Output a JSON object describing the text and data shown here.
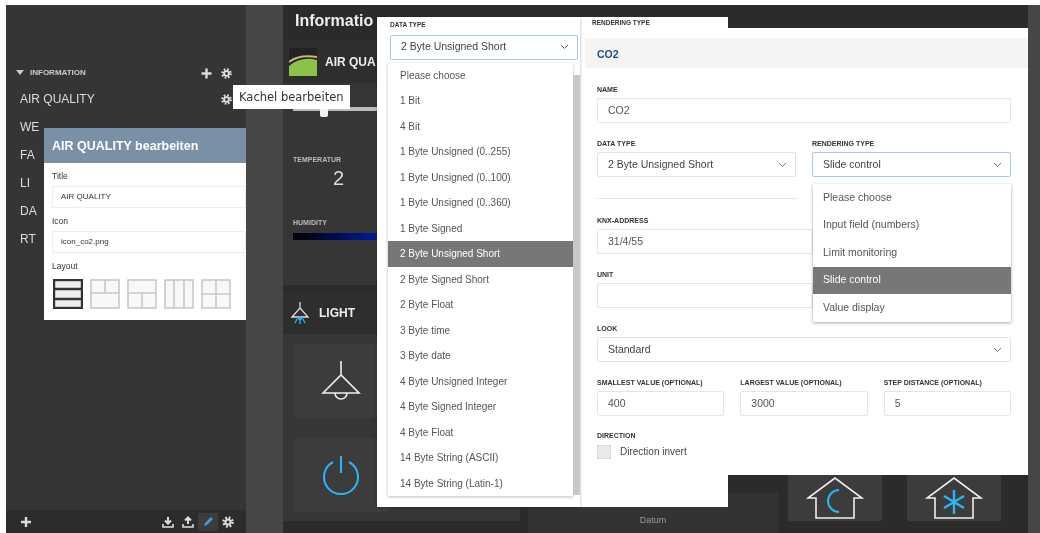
{
  "sidebar": {
    "section": {
      "label": "INFORMATION",
      "expanded": true
    },
    "items": [
      {
        "label": "AIR QUALITY",
        "settings_icon": true
      },
      {
        "label": "WE",
        "settings_icon": false
      },
      {
        "label": "FA",
        "settings_icon": false
      },
      {
        "label": "LI",
        "settings_icon": false
      },
      {
        "label": "DA",
        "settings_icon": false
      },
      {
        "label": "RT",
        "settings_icon": false
      }
    ],
    "toolbar": [
      {
        "kind": "add",
        "selected": false
      },
      {
        "kind": "download",
        "selected": false
      },
      {
        "kind": "upload",
        "selected": false
      },
      {
        "kind": "edit",
        "selected": true
      },
      {
        "kind": "settings",
        "selected": false
      }
    ]
  },
  "tooltip": "Kachel bearbeiten",
  "tile_editor": {
    "title": "AIR QUALITY bearbeiten",
    "fields": [
      {
        "label": "Title",
        "value": "AIR QUALITY"
      },
      {
        "label": "Icon",
        "value": "icon_co2.png"
      }
    ],
    "layout_label": "Layout",
    "layouts": [
      {
        "kind": "rows",
        "selected": true
      },
      {
        "kind": "top-split",
        "selected": false
      },
      {
        "kind": "bottom-split",
        "selected": false
      },
      {
        "kind": "columns",
        "selected": false
      },
      {
        "kind": "grid",
        "selected": false
      }
    ]
  },
  "dashboard": {
    "title": "Informatio",
    "air_quality": {
      "title": "AIR QUA",
      "slider": {
        "level": 0.37
      },
      "temperature": {
        "label": "TEMPERATUR",
        "value": "2"
      },
      "humidity": {
        "label": "HUMIDITY"
      }
    },
    "light": {
      "title": "LIGHT"
    },
    "datum": "Datum"
  },
  "data_type_dropdown": {
    "label": "DATA TYPE",
    "value": "2 Byte Unsigned Short",
    "options": [
      {
        "label": "Please choose",
        "selected": false
      },
      {
        "label": "1 Bit",
        "selected": false
      },
      {
        "label": "4 Bit",
        "selected": false
      },
      {
        "label": "1 Byte Unsigned (0..255)",
        "selected": false
      },
      {
        "label": "1 Byte Unsigned (0..100)",
        "selected": false
      },
      {
        "label": "1 Byte Unsigned (0..360)",
        "selected": false
      },
      {
        "label": "1 Byte Signed",
        "selected": false
      },
      {
        "label": "2 Byte Unsigned Short",
        "selected": true
      },
      {
        "label": "2 Byte Signed Short",
        "selected": false
      },
      {
        "label": "2 Byte Float",
        "selected": false
      },
      {
        "label": "3 Byte time",
        "selected": false
      },
      {
        "label": "3 Byte date",
        "selected": false
      },
      {
        "label": "4 Byte Unsigned Integer",
        "selected": false
      },
      {
        "label": "4 Byte Signed Integer",
        "selected": false
      },
      {
        "label": "4 Byte Float",
        "selected": false
      },
      {
        "label": "14 Byte String (ASCII)",
        "selected": false
      },
      {
        "label": "14 Byte String (Latin-1)",
        "selected": false
      }
    ]
  },
  "rendering_panel": {
    "label": "RENDERING TYPE"
  },
  "channel_dialog": {
    "title": "CO2",
    "name": {
      "label": "NAME",
      "value": "CO2"
    },
    "data_type": {
      "label": "DATA TYPE",
      "value": "2 Byte Unsigned Short"
    },
    "rendering_type": {
      "label": "RENDERING TYPE",
      "value": "Slide control",
      "expanded": true,
      "options": [
        {
          "label": "Please choose",
          "selected": false
        },
        {
          "label": "Input field (numbers)",
          "selected": false
        },
        {
          "label": "Limit monitoring",
          "selected": false
        },
        {
          "label": "Slide control",
          "selected": true
        },
        {
          "label": "Value display",
          "selected": false
        }
      ]
    },
    "knx_address": {
      "label": "KNX-ADDRESS",
      "value": "31/4/55"
    },
    "unit": {
      "label": "UNIT"
    },
    "look": {
      "label": "LOOK",
      "value": "Standard"
    },
    "ranges": [
      {
        "label": "SMALLEST VALUE (OPTIONAL)",
        "value": "400"
      },
      {
        "label": "LARGEST VALUE (OPTIONAL)",
        "value": "3000"
      },
      {
        "label": "STEP DISTANCE (OPTIONAL)",
        "value": "5"
      }
    ],
    "direction": {
      "label": "DIRECTION",
      "option": "Direction invert",
      "checked": false
    }
  }
}
